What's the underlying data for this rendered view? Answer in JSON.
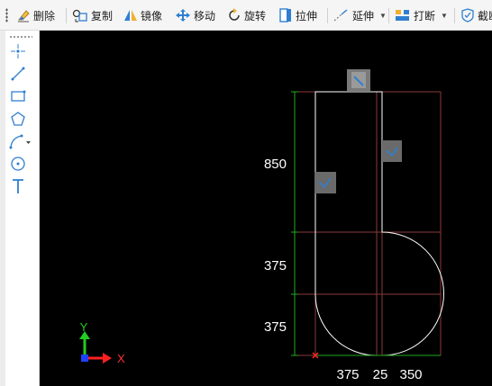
{
  "toolbar": {
    "items": [
      {
        "label": "删除",
        "icon": "eraser-icon"
      },
      {
        "label": "复制",
        "icon": "copy-icon"
      },
      {
        "label": "镜像",
        "icon": "mirror-icon"
      },
      {
        "label": "移动",
        "icon": "move-icon"
      },
      {
        "label": "旋转",
        "icon": "rotate-icon"
      },
      {
        "label": "拉伸",
        "icon": "stretch-icon"
      },
      {
        "label": "延伸",
        "icon": "extend-icon"
      },
      {
        "label": "打断",
        "icon": "break-icon"
      },
      {
        "label": "截断",
        "icon": "trim-icon"
      }
    ]
  },
  "left_tools": [
    {
      "name": "point-tool",
      "icon": "point-icon"
    },
    {
      "name": "line-tool",
      "icon": "line-icon"
    },
    {
      "name": "rectangle-tool",
      "icon": "rectangle-icon"
    },
    {
      "name": "polygon-tool",
      "icon": "pentagon-icon"
    },
    {
      "name": "polyline-tool",
      "icon": "polyline-icon"
    },
    {
      "name": "circle-tool",
      "icon": "circle-icon"
    },
    {
      "name": "text-tool",
      "icon": "text-icon"
    }
  ],
  "dimensions": {
    "vertical": [
      "850",
      "375",
      "375"
    ],
    "horizontal": [
      "375",
      "25",
      "350"
    ]
  },
  "axis": {
    "x": "X",
    "y": "Y"
  },
  "colors": {
    "canvas": "#000000",
    "shape": "#ffffff",
    "dimension_line": "#22aa22",
    "grid_line": "#8b3a3a",
    "toolbar_text": "#222222",
    "icon_blue": "#2f7fd0"
  }
}
